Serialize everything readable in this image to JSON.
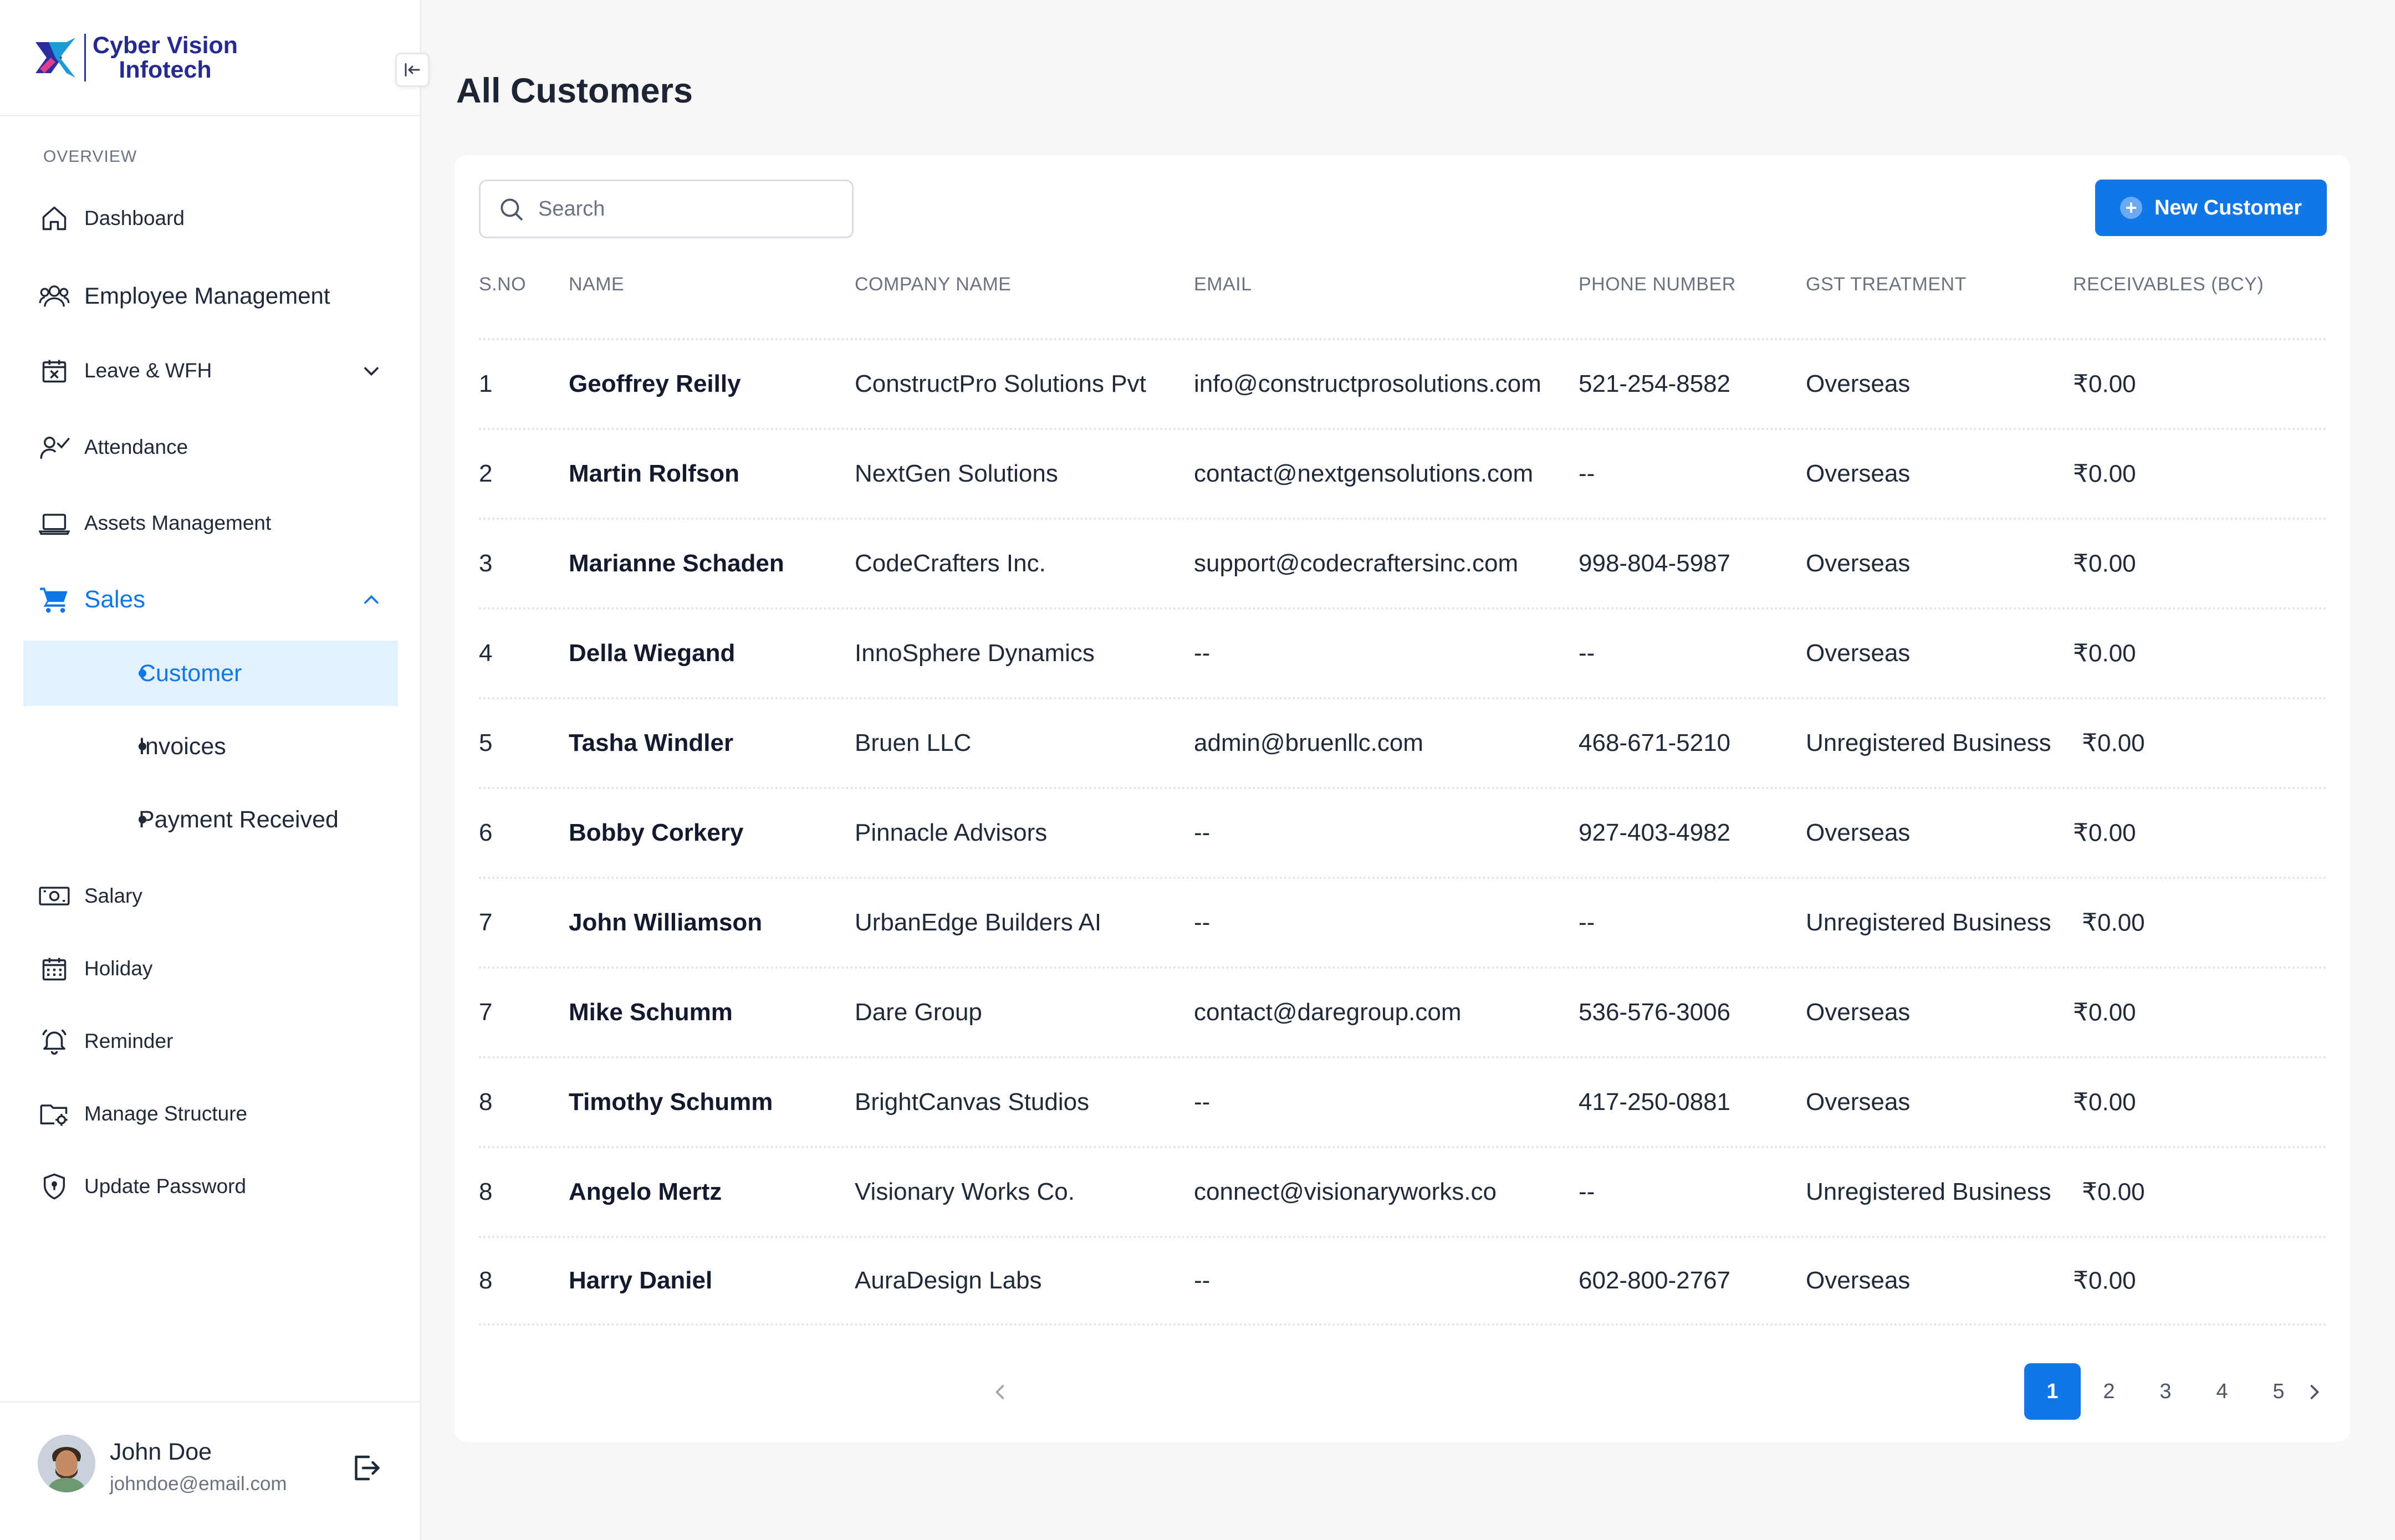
{
  "brand": {
    "line1": "Cyber Vision",
    "line2": "Infotech"
  },
  "sidebar": {
    "section_label": "OVERVIEW",
    "items": [
      {
        "label": "Dashboard",
        "icon": "home-icon"
      },
      {
        "label": "Employee Management",
        "icon": "users-icon"
      },
      {
        "label": "Leave & WFH",
        "icon": "calendar-x-icon"
      },
      {
        "label": "Attendance",
        "icon": "user-check-icon"
      },
      {
        "label": "Assets Management",
        "icon": "laptop-icon"
      },
      {
        "label": "Sales",
        "icon": "cart-icon"
      },
      {
        "label": "Salary",
        "icon": "cash-icon"
      },
      {
        "label": "Holiday",
        "icon": "calendar-icon"
      },
      {
        "label": "Reminder",
        "icon": "bell-icon"
      },
      {
        "label": "Manage Structure",
        "icon": "folder-settings-icon"
      },
      {
        "label": "Update Password",
        "icon": "shield-icon"
      }
    ],
    "sales_sub": [
      {
        "label": "Customer",
        "active": true
      },
      {
        "label": "Invoices",
        "active": false
      },
      {
        "label": "Payment Received",
        "active": false
      }
    ]
  },
  "user": {
    "name": "John Doe",
    "email": "johndoe@email.com"
  },
  "page": {
    "title": "All Customers"
  },
  "search": {
    "placeholder": "Search",
    "value": ""
  },
  "toolbar": {
    "new_label": "New Customer"
  },
  "table": {
    "headers": [
      "S.NO",
      "NAME",
      "COMPANY NAME",
      "EMAIL",
      "PHONE NUMBER",
      "GST TREATMENT",
      "RECEIVABLES (BCY)"
    ],
    "rows": [
      [
        "1",
        "Geoffrey Reilly",
        "ConstructPro Solutions Pvt",
        "info@constructprosolutions.com",
        "521-254-8582",
        "Overseas",
        "₹0.00"
      ],
      [
        "2",
        "Martin Rolfson",
        "NextGen Solutions",
        "contact@nextgensolutions.com",
        "--",
        "Overseas",
        "₹0.00"
      ],
      [
        "3",
        "Marianne Schaden",
        "CodeCrafters Inc.",
        "support@codecraftersinc.com",
        "998-804-5987",
        "Overseas",
        "₹0.00"
      ],
      [
        "4",
        "Della Wiegand",
        "InnoSphere Dynamics",
        "--",
        "--",
        "Overseas",
        "₹0.00"
      ],
      [
        "5",
        "Tasha Windler",
        "Bruen LLC",
        "admin@bruenllc.com",
        "468-671-5210",
        "Unregistered Business",
        "₹0.00"
      ],
      [
        "6",
        "Bobby Corkery",
        "Pinnacle Advisors",
        "--",
        "927-403-4982",
        "Overseas",
        "₹0.00"
      ],
      [
        "7",
        "John Williamson",
        "UrbanEdge Builders AI",
        "--",
        "--",
        "Unregistered Business",
        "₹0.00"
      ],
      [
        "7",
        "Mike Schumm",
        "Dare Group",
        "contact@daregroup.com",
        "536-576-3006",
        "Overseas",
        "₹0.00"
      ],
      [
        "8",
        "Timothy Schumm",
        "BrightCanvas Studios",
        "--",
        "417-250-0881",
        "Overseas",
        "₹0.00"
      ],
      [
        "8",
        "Angelo Mertz",
        "Visionary Works Co.",
        "connect@visionaryworks.co",
        "--",
        "Unregistered Business",
        "₹0.00"
      ],
      [
        "8",
        "Harry Daniel",
        "AuraDesign Labs",
        "--",
        "602-800-2767",
        "Overseas",
        "₹0.00"
      ]
    ]
  },
  "pagination": {
    "pages": [
      "1",
      "2",
      "3",
      "4",
      "5"
    ],
    "current": "1"
  },
  "colors": {
    "accent": "#1177e8",
    "active_bg": "#e3f0fd",
    "brand": "#262a8f"
  }
}
